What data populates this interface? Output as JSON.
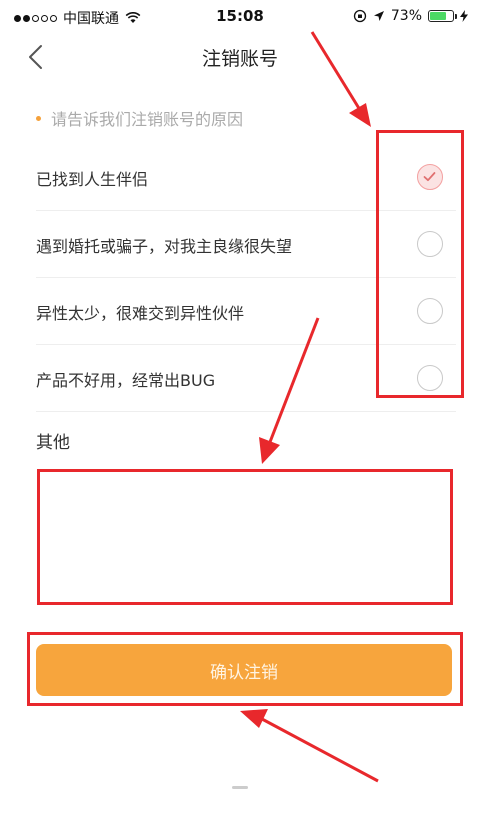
{
  "status_bar": {
    "carrier": "中国联通",
    "time": "15:08",
    "battery_percent": "73%",
    "battery_level": 0.73
  },
  "nav": {
    "title": "注销账号"
  },
  "form": {
    "hint": "请告诉我们注销账号的原因",
    "reasons": [
      {
        "label": "已找到人生伴侣",
        "selected": true
      },
      {
        "label": "遇到婚托或骗子，对我主良缘很失望",
        "selected": false
      },
      {
        "label": "异性太少，很难交到异性伙伴",
        "selected": false
      },
      {
        "label": "产品不好用，经常出BUG",
        "selected": false
      }
    ],
    "other_label": "其他",
    "other_value": "",
    "confirm_label": "确认注销"
  },
  "colors": {
    "accent": "#f7a53d",
    "annotation": "#e8282c",
    "checked_radio": "#f3a0a0"
  }
}
